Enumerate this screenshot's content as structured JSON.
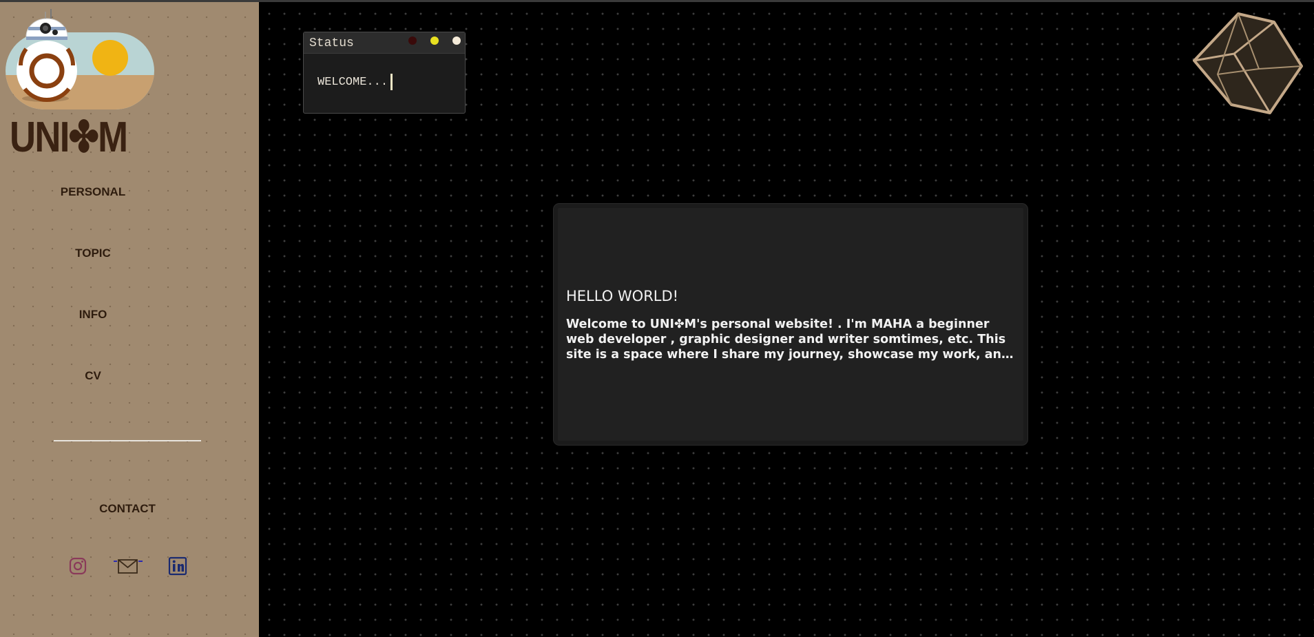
{
  "brand": {
    "logo_text": "UNI✤M"
  },
  "sidebar": {
    "nav": [
      {
        "label": "PERSONAL"
      },
      {
        "label": "TOPIC"
      },
      {
        "label": "INFO"
      },
      {
        "label": "CV"
      }
    ],
    "contact_label": "CONTACT",
    "social": [
      {
        "icon": "instagram-icon"
      },
      {
        "icon": "mail-icon"
      },
      {
        "icon": "linkedin-icon"
      }
    ]
  },
  "status_window": {
    "title": "Status",
    "text": "WELCOME...",
    "dot_colors": [
      "#3a0a0a",
      "#e8e020",
      "#f4ead8"
    ]
  },
  "card": {
    "title": "HELLO WORLD!",
    "text": "Welcome to UNI✤M's personal website! . I'm MAHA a beginner web developer , graphic designer and writer somtimes, etc. This site is a space where I share my journey, showcase my work, and connect with others."
  },
  "colors": {
    "sidebar_bg": "#a08a70",
    "nav_text": "#2e1c0e",
    "main_bg": "#000000",
    "card_bg": "#212121",
    "cube_stroke": "#c4a888"
  }
}
